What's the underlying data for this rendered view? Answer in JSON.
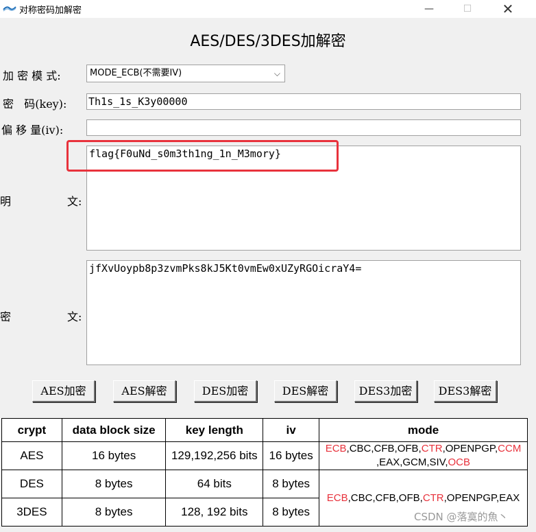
{
  "window": {
    "title": "对称密码加解密",
    "minimize_glyph": "—",
    "maximize_glyph": "☐",
    "close_glyph": "✕"
  },
  "heading": "AES/DES/3DES加解密",
  "form": {
    "mode_label": "加 密 模 式:",
    "mode_value": "MODE_ECB(不需要IV)",
    "key_label": "密   码(key):",
    "key_value": "Th1s_1s_K3y00000",
    "iv_label": "偏 移 量(iv):",
    "iv_value": "",
    "plain_label_left": "明",
    "plain_label_right": "文:",
    "plaintext": "flag{F0uNd_s0m3th1ng_1n_M3mory}",
    "cipher_label_left": "密",
    "cipher_label_right": "文:",
    "ciphertext": "jfXvUoypb8p3zvmPks8kJ5Kt0vmEw0xUZyRGOicraY4="
  },
  "buttons": {
    "aes_encrypt": "AES加密",
    "aes_decrypt": "AES解密",
    "des_encrypt": "DES加密",
    "des_decrypt": "DES解密",
    "des3_encrypt": "DES3加密",
    "des3_decrypt": "DES3解密"
  },
  "table": {
    "headers": [
      "crypt",
      "data block size",
      "key length",
      "iv",
      "mode"
    ],
    "rows": [
      {
        "crypt": "AES",
        "block": "16 bytes",
        "key": "129,192,256 bits",
        "iv": "16 bytes"
      },
      {
        "crypt": "DES",
        "block": "8 bytes",
        "key": "64 bits",
        "iv": "8 bytes"
      },
      {
        "crypt": "3DES",
        "block": "8 bytes",
        "key": "128, 192 bits",
        "iv": "8 bytes"
      }
    ],
    "aes_modes": {
      "m1": "ECB",
      "m2": ",CBC,CFB,OFB,",
      "m3": "CTR",
      "m4": ",OPENPGP,",
      "m5": "CCM",
      "m6": ",EAX,GCM,SIV,",
      "m7": "OCB"
    },
    "des_modes": {
      "m1": "ECB",
      "m2": ",CBC,CFB,OFB,",
      "m3": "CTR",
      "m4": ",OPENPGP,EAX"
    }
  },
  "colors": {
    "highlight": "#e8323c",
    "mode_red": "#e8323c"
  },
  "watermark": "CSDN @落寞的魚丶"
}
